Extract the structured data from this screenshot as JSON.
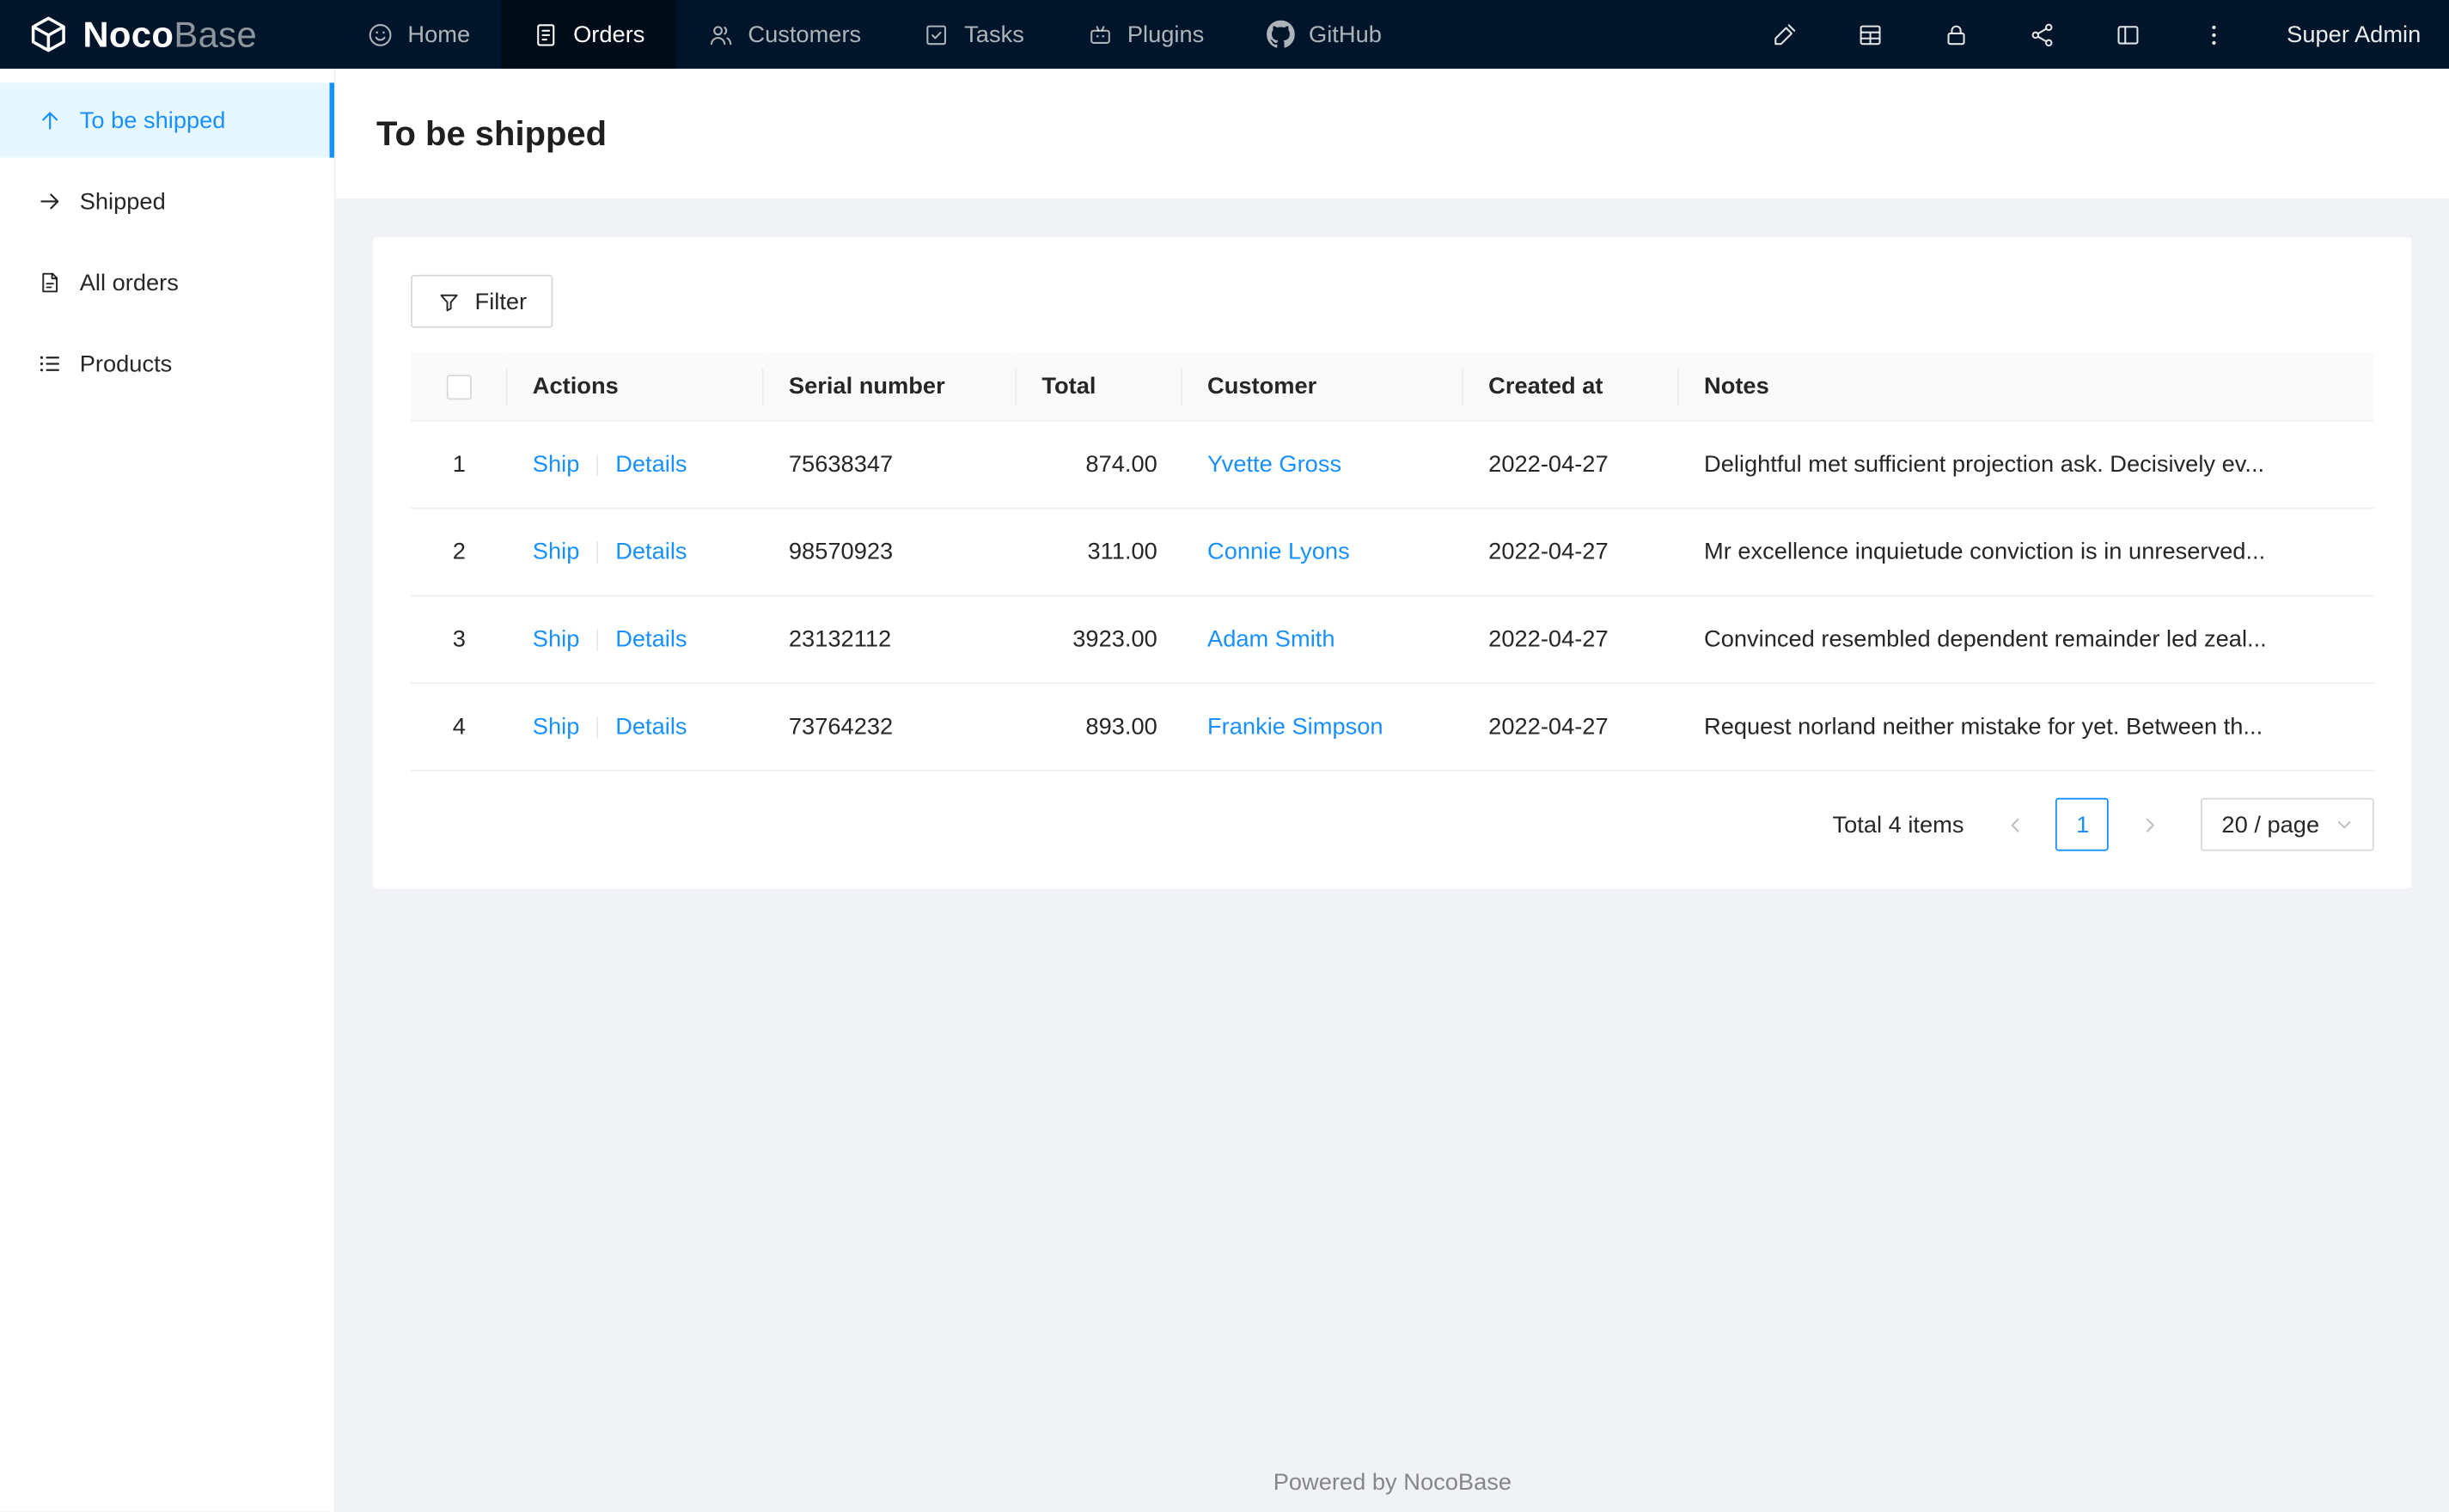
{
  "navbar": {
    "logo": {
      "primary": "Noco",
      "secondary": "Base",
      "icon": "cube-logo-icon"
    },
    "items": [
      {
        "label": "Home",
        "icon": "smile-icon",
        "active": false
      },
      {
        "label": "Orders",
        "icon": "clipboard-icon",
        "active": true
      },
      {
        "label": "Customers",
        "icon": "customers-icon",
        "active": false
      },
      {
        "label": "Tasks",
        "icon": "check-square-icon",
        "active": false
      },
      {
        "label": "Plugins",
        "icon": "robot-icon",
        "active": false
      },
      {
        "label": "GitHub",
        "icon": "github-icon",
        "active": false
      }
    ],
    "tools": [
      "highlighter-icon",
      "collections-icon",
      "lock-icon",
      "share-icon",
      "layout-icon",
      "more-icon"
    ],
    "user": "Super Admin"
  },
  "sidebar": {
    "items": [
      {
        "label": "To be shipped",
        "icon": "arrow-up-icon",
        "active": true
      },
      {
        "label": "Shipped",
        "icon": "arrow-right-icon",
        "active": false
      },
      {
        "label": "All orders",
        "icon": "file-icon",
        "active": false
      },
      {
        "label": "Products",
        "icon": "list-icon",
        "active": false
      }
    ]
  },
  "page": {
    "title": "To be shipped"
  },
  "toolbar": {
    "filter_label": "Filter"
  },
  "table": {
    "columns": [
      "Actions",
      "Serial number",
      "Total",
      "Customer",
      "Created at",
      "Notes"
    ],
    "actions": {
      "ship": "Ship",
      "details": "Details"
    },
    "rows": [
      {
        "index": "1",
        "serial_number": "75638347",
        "total": "874.00",
        "customer": "Yvette Gross",
        "created_at": "2022-04-27",
        "notes": "Delightful met sufficient projection ask. Decisively ev..."
      },
      {
        "index": "2",
        "serial_number": "98570923",
        "total": "311.00",
        "customer": "Connie Lyons",
        "created_at": "2022-04-27",
        "notes": "Mr excellence inquietude conviction is in unreserved..."
      },
      {
        "index": "3",
        "serial_number": "23132112",
        "total": "3923.00",
        "customer": "Adam Smith",
        "created_at": "2022-04-27",
        "notes": "Convinced resembled dependent remainder led zeal..."
      },
      {
        "index": "4",
        "serial_number": "73764232",
        "total": "893.00",
        "customer": "Frankie Simpson",
        "created_at": "2022-04-27",
        "notes": "Request norland neither mistake for yet. Between th..."
      }
    ]
  },
  "pagination": {
    "total_text": "Total 4 items",
    "current_page": "1",
    "page_size": "20 / page"
  },
  "footer": {
    "text": "Powered by NocoBase"
  },
  "colors": {
    "accent": "#1890ff",
    "navbar_bg": "#001529",
    "navbar_active_bg": "#000c17",
    "sidebar_active_bg": "#e6f7ff",
    "content_bg": "#f0f2f5",
    "table_header_bg": "#fafafa",
    "border": "#f0f0f0"
  }
}
